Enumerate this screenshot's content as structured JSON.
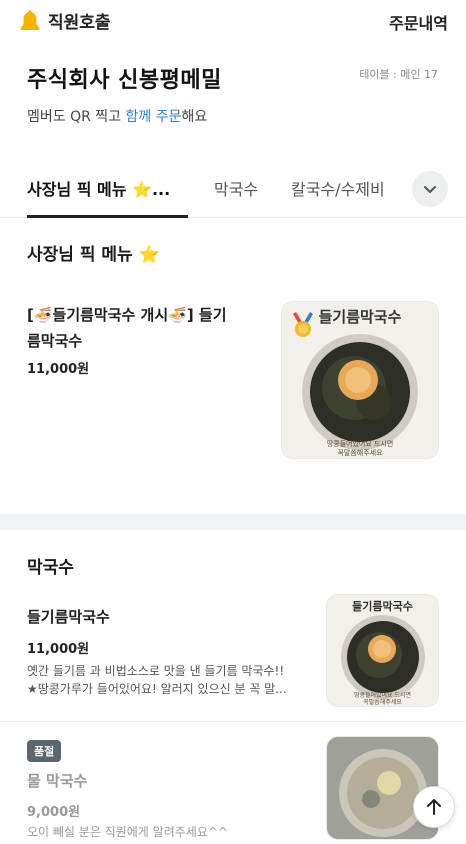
{
  "header": {
    "call_label": "직원호출",
    "orders_label": "주문내역"
  },
  "store": {
    "name": "주식회사 신봉평메밀",
    "table": "테이블 : 메인 17",
    "subtitle_pre": "멤버도 QR 찍고 ",
    "subtitle_highlight": "함께 주문",
    "subtitle_post": "해요"
  },
  "tabs": [
    {
      "label": "사장님 픽 메뉴 ⭐...",
      "active": true
    },
    {
      "label": "막국수",
      "active": false
    },
    {
      "label": "칼국수/수제비",
      "active": false
    }
  ],
  "sections": {
    "pick": {
      "title": "사장님 픽 메뉴 ⭐",
      "item": {
        "name_line1": "[🍜들기름막국수 개시🍜] 들기",
        "name_line2": "름막국수",
        "price": "11,000원",
        "image_title": "들기름막국수",
        "image_caption_line1": "땅콩들어있어요 드시면",
        "image_caption_line2": "꼭말씀해주세요"
      }
    },
    "makguksu": {
      "title": "막국수",
      "items": [
        {
          "name": "들기름막국수",
          "price": "11,000원",
          "desc_line1": "옛간 들기름 과 비법소스로 맛을 낸 들기름 막국수!!",
          "desc_line2": "★땅콩가루가 들어있어요! 알러지 있으신 분 꼭 말...",
          "image_title": "들기름막국수",
          "image_caption_line1": "땅콩들어있어요 드시면",
          "image_caption_line2": "꼭말씀해주세요"
        },
        {
          "badge": "품절",
          "name": "물 막국수",
          "price": "9,000원",
          "desc_line1": "오이 빼실 분은 직원에게 알려주세요^^"
        }
      ]
    }
  },
  "colors": {
    "accent": "#2f7fd3",
    "bell": "#f5b400",
    "badge": "#5d6670"
  },
  "icons": {
    "call": "bell-icon",
    "more": "chevron-down-icon",
    "scroll_top": "arrow-up-icon",
    "medal": "medal-icon"
  }
}
